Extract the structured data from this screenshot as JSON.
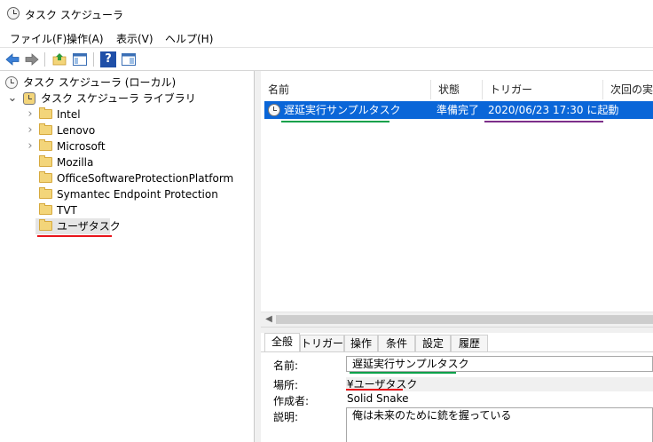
{
  "colors": {
    "selection": "#0a66d8",
    "underline_red": "#e8141b",
    "underline_green": "#0aa14a",
    "underline_purple": "#7d2f8a",
    "folder": "#f3d57a"
  },
  "window": {
    "title": "タスク スケジューラ",
    "icon": "clock-icon"
  },
  "menu": [
    {
      "label": "ファイル(F)"
    },
    {
      "label": "操作(A)"
    },
    {
      "label": "表示(V)"
    },
    {
      "label": "ヘルプ(H)"
    }
  ],
  "toolbar": {
    "back_icon": "back-arrow-icon",
    "forward_icon": "forward-arrow-icon",
    "up_icon": "folder-up-icon",
    "show_hide_icon": "console-tree-icon",
    "help_icon": "help-icon",
    "help_glyph": "?",
    "action_pane_icon": "action-pane-icon"
  },
  "tree": {
    "root": "タスク スケジューラ (ローカル)",
    "library": "タスク スケジューラ ライブラリ",
    "folders": [
      {
        "label": "Intel",
        "expandable": true
      },
      {
        "label": "Lenovo",
        "expandable": true
      },
      {
        "label": "Microsoft",
        "expandable": true
      },
      {
        "label": "Mozilla",
        "expandable": false
      },
      {
        "label": "OfficeSoftwareProtectionPlatform",
        "expandable": false
      },
      {
        "label": "Symantec Endpoint Protection",
        "expandable": false
      },
      {
        "label": "TVT",
        "expandable": false
      },
      {
        "label": "ユーザタスク",
        "expandable": false,
        "selected": true
      }
    ]
  },
  "task_list": {
    "columns": [
      "名前",
      "状態",
      "トリガー",
      "次回の実行"
    ],
    "rows": [
      {
        "name": "遅延実行サンプルタスク",
        "status": "準備完了",
        "trigger": "2020/06/23 17:30 に起動",
        "selected": true
      }
    ]
  },
  "details": {
    "tabs": [
      "全般",
      "トリガー",
      "操作",
      "条件",
      "設定",
      "履歴"
    ],
    "active_tab": "全般",
    "name_label": "名前:",
    "name_value": "遅延実行サンプルタスク",
    "location_label": "場所:",
    "location_value": "¥ユーザタスク",
    "author_label": "作成者:",
    "author_value": "Solid Snake",
    "description_label": "説明:",
    "description_value": "俺は未来のために銃を握っている"
  }
}
